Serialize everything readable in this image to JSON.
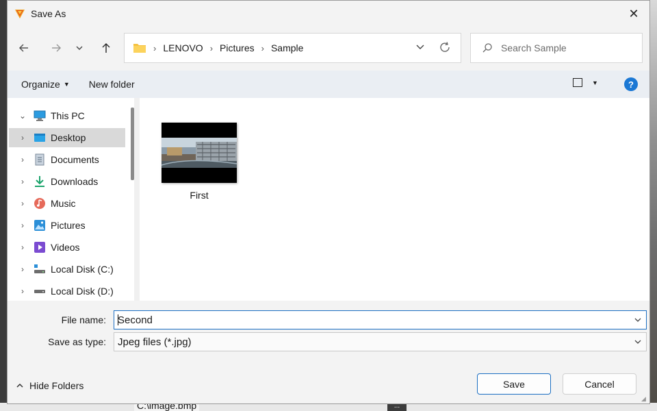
{
  "window": {
    "title": "Save As",
    "close_glyph": "✕"
  },
  "background": {
    "path_text": "C:\\image.bmp",
    "ellipsis": "..."
  },
  "navigation": {
    "back_icon": "arrow-left",
    "forward_icon": "arrow-right",
    "recent_icon": "chevron-down",
    "up_icon": "arrow-up"
  },
  "address": {
    "crumbs": [
      "LENOVO",
      "Pictures",
      "Sample"
    ],
    "separator": "›"
  },
  "search": {
    "placeholder": "Search Sample"
  },
  "commandbar": {
    "organize_label": "Organize",
    "new_folder_label": "New folder",
    "help_label": "?"
  },
  "navpane": {
    "items": [
      {
        "label": "This PC",
        "icon": "computer-icon",
        "selected": false
      },
      {
        "label": "Desktop",
        "icon": "desktop-icon",
        "selected": true
      },
      {
        "label": "Documents",
        "icon": "documents-icon",
        "selected": false
      },
      {
        "label": "Downloads",
        "icon": "downloads-icon",
        "selected": false
      },
      {
        "label": "Music",
        "icon": "music-icon",
        "selected": false
      },
      {
        "label": "Pictures",
        "icon": "pictures-icon",
        "selected": false
      },
      {
        "label": "Videos",
        "icon": "videos-icon",
        "selected": false
      },
      {
        "label": "Local Disk (C:)",
        "icon": "drive-c-icon",
        "selected": false
      },
      {
        "label": "Local Disk (D:)",
        "icon": "drive-d-icon",
        "selected": false
      }
    ]
  },
  "files": [
    {
      "name": "First",
      "type": "image-thumbnail"
    }
  ],
  "form": {
    "file_name_label": "File name:",
    "file_name_value": "Second",
    "save_type_label": "Save as type:",
    "save_type_value": "Jpeg files (*.jpg)"
  },
  "footer": {
    "hide_folders_label": "Hide Folders",
    "save_label": "Save",
    "cancel_label": "Cancel"
  },
  "colors": {
    "accent": "#1b6ec2",
    "help_blue": "#1b78d4",
    "selected_row": "#d9d9d9",
    "cmdbar_bg": "#eaeef3"
  }
}
